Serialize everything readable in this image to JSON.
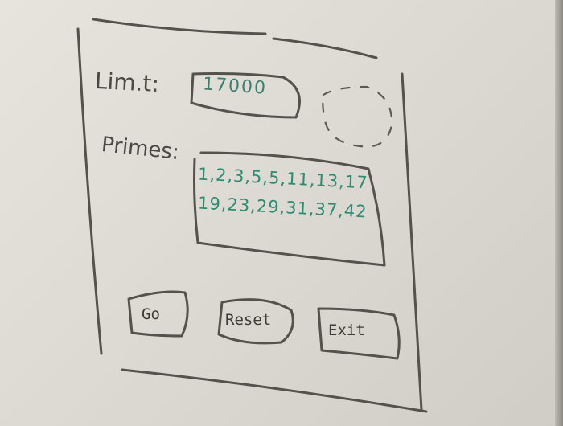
{
  "form": {
    "limit_label": "Lim.t:",
    "limit_value": "17000",
    "primes_label": "Primes:",
    "primes_line1": "1,2,3,5,5,11,13,17",
    "primes_line2": "19,23,29,31,37,42"
  },
  "buttons": {
    "go": "Go",
    "reset": "Reset",
    "exit": "Exit"
  },
  "colors": {
    "ink": "#55524d",
    "green_marker": "#2f8a72",
    "board": "#e2e0d9"
  }
}
